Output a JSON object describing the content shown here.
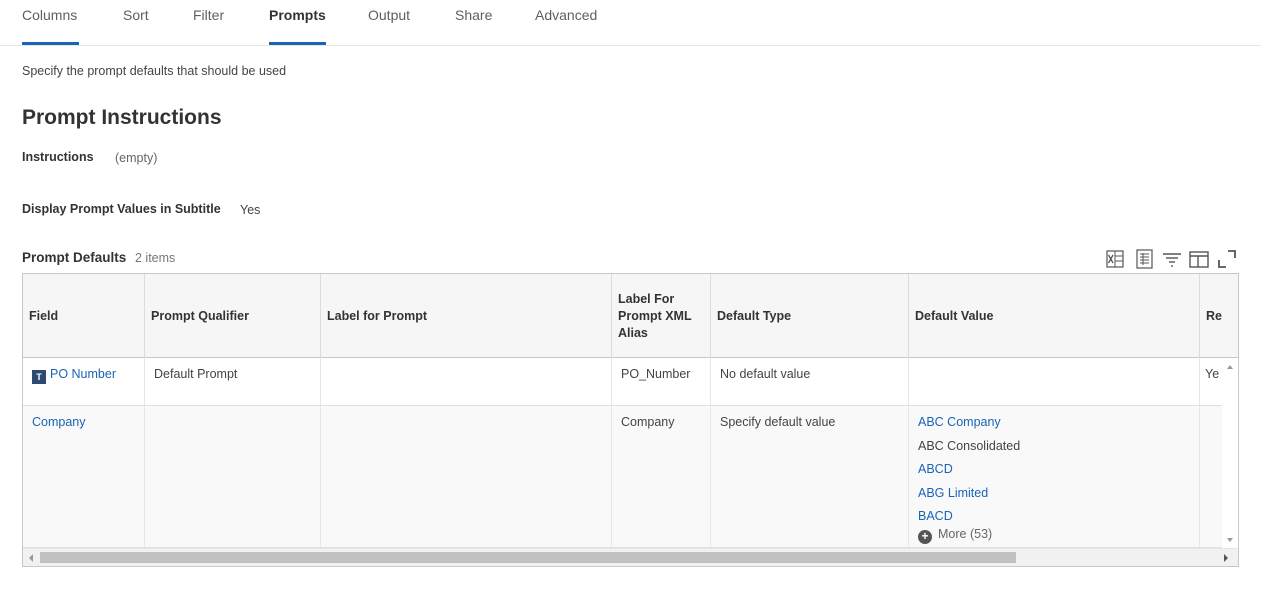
{
  "tabs": [
    {
      "label": "Columns",
      "active": false
    },
    {
      "label": "Sort",
      "active": false
    },
    {
      "label": "Filter",
      "active": false
    },
    {
      "label": "Prompts",
      "active": true
    },
    {
      "label": "Output",
      "active": false
    },
    {
      "label": "Share",
      "active": false
    },
    {
      "label": "Advanced",
      "active": false
    }
  ],
  "page": {
    "subtitle": "Specify the prompt defaults that should be used",
    "title": "Prompt Instructions"
  },
  "fields": {
    "instructions_label": "Instructions",
    "instructions_value": "(empty)",
    "display_label": "Display Prompt Values in Subtitle",
    "display_value": "Yes"
  },
  "grid": {
    "title": "Prompt Defaults",
    "count": "2 items",
    "toolbar_icons": [
      "export-excel-icon",
      "export-pdf-icon",
      "filter-icon",
      "column-layout-icon",
      "fullscreen-icon"
    ],
    "columns": [
      "Field",
      "Prompt Qualifier",
      "Label for Prompt",
      "Label For Prompt XML Alias",
      "Default Type",
      "Default Value",
      "Re"
    ],
    "rows": [
      {
        "field": "PO Number",
        "field_badge": "T",
        "prompt_qualifier": "Default Prompt",
        "label_for_prompt": "",
        "xml_alias": "PO_Number",
        "default_type": "No default value",
        "default_values": [],
        "re": "Ye"
      },
      {
        "field": "Company",
        "prompt_qualifier": "",
        "label_for_prompt": "",
        "xml_alias": "Company",
        "default_type": "Specify default value",
        "default_values": [
          {
            "text": "ABC Company",
            "link": true
          },
          {
            "text": "ABC Consolidated",
            "link": false
          },
          {
            "text": "ABCD",
            "link": true
          },
          {
            "text": "ABG Limited",
            "link": true
          },
          {
            "text": "BACD",
            "link": true
          }
        ],
        "more_label": "More (53)",
        "re": ""
      }
    ]
  },
  "colors": {
    "accent": "#1a63b6",
    "badge": "#2c4a73"
  }
}
